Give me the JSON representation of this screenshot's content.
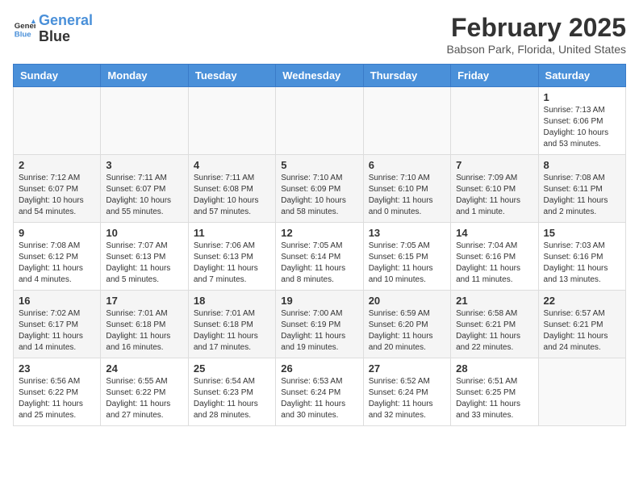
{
  "header": {
    "logo_line1": "General",
    "logo_line2": "Blue",
    "title": "February 2025",
    "subtitle": "Babson Park, Florida, United States"
  },
  "days_of_week": [
    "Sunday",
    "Monday",
    "Tuesday",
    "Wednesday",
    "Thursday",
    "Friday",
    "Saturday"
  ],
  "weeks": [
    [
      {
        "num": "",
        "info": ""
      },
      {
        "num": "",
        "info": ""
      },
      {
        "num": "",
        "info": ""
      },
      {
        "num": "",
        "info": ""
      },
      {
        "num": "",
        "info": ""
      },
      {
        "num": "",
        "info": ""
      },
      {
        "num": "1",
        "info": "Sunrise: 7:13 AM\nSunset: 6:06 PM\nDaylight: 10 hours\nand 53 minutes."
      }
    ],
    [
      {
        "num": "2",
        "info": "Sunrise: 7:12 AM\nSunset: 6:07 PM\nDaylight: 10 hours\nand 54 minutes."
      },
      {
        "num": "3",
        "info": "Sunrise: 7:11 AM\nSunset: 6:07 PM\nDaylight: 10 hours\nand 55 minutes."
      },
      {
        "num": "4",
        "info": "Sunrise: 7:11 AM\nSunset: 6:08 PM\nDaylight: 10 hours\nand 57 minutes."
      },
      {
        "num": "5",
        "info": "Sunrise: 7:10 AM\nSunset: 6:09 PM\nDaylight: 10 hours\nand 58 minutes."
      },
      {
        "num": "6",
        "info": "Sunrise: 7:10 AM\nSunset: 6:10 PM\nDaylight: 11 hours\nand 0 minutes."
      },
      {
        "num": "7",
        "info": "Sunrise: 7:09 AM\nSunset: 6:10 PM\nDaylight: 11 hours\nand 1 minute."
      },
      {
        "num": "8",
        "info": "Sunrise: 7:08 AM\nSunset: 6:11 PM\nDaylight: 11 hours\nand 2 minutes."
      }
    ],
    [
      {
        "num": "9",
        "info": "Sunrise: 7:08 AM\nSunset: 6:12 PM\nDaylight: 11 hours\nand 4 minutes."
      },
      {
        "num": "10",
        "info": "Sunrise: 7:07 AM\nSunset: 6:13 PM\nDaylight: 11 hours\nand 5 minutes."
      },
      {
        "num": "11",
        "info": "Sunrise: 7:06 AM\nSunset: 6:13 PM\nDaylight: 11 hours\nand 7 minutes."
      },
      {
        "num": "12",
        "info": "Sunrise: 7:05 AM\nSunset: 6:14 PM\nDaylight: 11 hours\nand 8 minutes."
      },
      {
        "num": "13",
        "info": "Sunrise: 7:05 AM\nSunset: 6:15 PM\nDaylight: 11 hours\nand 10 minutes."
      },
      {
        "num": "14",
        "info": "Sunrise: 7:04 AM\nSunset: 6:16 PM\nDaylight: 11 hours\nand 11 minutes."
      },
      {
        "num": "15",
        "info": "Sunrise: 7:03 AM\nSunset: 6:16 PM\nDaylight: 11 hours\nand 13 minutes."
      }
    ],
    [
      {
        "num": "16",
        "info": "Sunrise: 7:02 AM\nSunset: 6:17 PM\nDaylight: 11 hours\nand 14 minutes."
      },
      {
        "num": "17",
        "info": "Sunrise: 7:01 AM\nSunset: 6:18 PM\nDaylight: 11 hours\nand 16 minutes."
      },
      {
        "num": "18",
        "info": "Sunrise: 7:01 AM\nSunset: 6:18 PM\nDaylight: 11 hours\nand 17 minutes."
      },
      {
        "num": "19",
        "info": "Sunrise: 7:00 AM\nSunset: 6:19 PM\nDaylight: 11 hours\nand 19 minutes."
      },
      {
        "num": "20",
        "info": "Sunrise: 6:59 AM\nSunset: 6:20 PM\nDaylight: 11 hours\nand 20 minutes."
      },
      {
        "num": "21",
        "info": "Sunrise: 6:58 AM\nSunset: 6:21 PM\nDaylight: 11 hours\nand 22 minutes."
      },
      {
        "num": "22",
        "info": "Sunrise: 6:57 AM\nSunset: 6:21 PM\nDaylight: 11 hours\nand 24 minutes."
      }
    ],
    [
      {
        "num": "23",
        "info": "Sunrise: 6:56 AM\nSunset: 6:22 PM\nDaylight: 11 hours\nand 25 minutes."
      },
      {
        "num": "24",
        "info": "Sunrise: 6:55 AM\nSunset: 6:22 PM\nDaylight: 11 hours\nand 27 minutes."
      },
      {
        "num": "25",
        "info": "Sunrise: 6:54 AM\nSunset: 6:23 PM\nDaylight: 11 hours\nand 28 minutes."
      },
      {
        "num": "26",
        "info": "Sunrise: 6:53 AM\nSunset: 6:24 PM\nDaylight: 11 hours\nand 30 minutes."
      },
      {
        "num": "27",
        "info": "Sunrise: 6:52 AM\nSunset: 6:24 PM\nDaylight: 11 hours\nand 32 minutes."
      },
      {
        "num": "28",
        "info": "Sunrise: 6:51 AM\nSunset: 6:25 PM\nDaylight: 11 hours\nand 33 minutes."
      },
      {
        "num": "",
        "info": ""
      }
    ]
  ]
}
